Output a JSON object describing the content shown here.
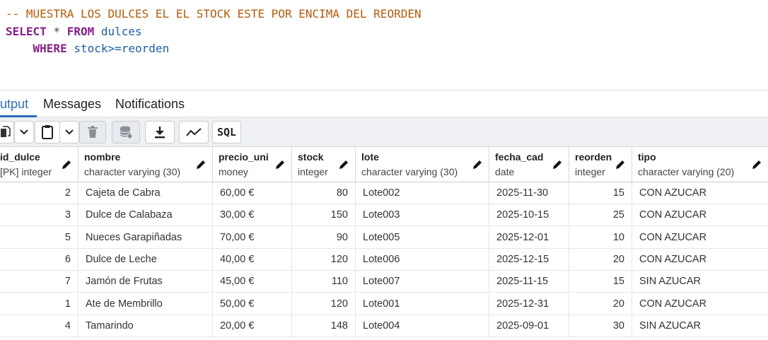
{
  "editor": {
    "line1": {
      "comment": "-- MUESTRA LOS DULCES EL EL STOCK ESTE POR ENCIMA DEL REORDEN"
    },
    "line2": {
      "kw_select": "SELECT",
      "star": " * ",
      "kw_from": "FROM",
      "table": " dulces"
    },
    "line3": {
      "indent": "    ",
      "kw_where": "WHERE",
      "condition": " stock>=reorden"
    }
  },
  "tabs": [
    {
      "label": "utput",
      "active": true
    },
    {
      "label": "Messages",
      "active": false
    },
    {
      "label": "Notifications",
      "active": false
    }
  ],
  "toolbar": {
    "sql_label": "SQL",
    "icons": [
      "copy-icon",
      "chevron-down-icon",
      "paste-icon",
      "chevron-down-icon",
      "delete-icon",
      "save-data-icon",
      "download-icon",
      "graph-icon"
    ]
  },
  "grid": {
    "columns": [
      {
        "name": "id_dulce",
        "type": "[PK] integer"
      },
      {
        "name": "nombre",
        "type": "character varying (30)"
      },
      {
        "name": "precio_uni",
        "type": "money"
      },
      {
        "name": "stock",
        "type": "integer"
      },
      {
        "name": "lote",
        "type": "character varying (30)"
      },
      {
        "name": "fecha_cad",
        "type": "date"
      },
      {
        "name": "reorden",
        "type": "integer"
      },
      {
        "name": "tipo",
        "type": "character varying (20)"
      }
    ],
    "rows": [
      [
        "2",
        "Cajeta de Cabra",
        "60,00 €",
        "80",
        "Lote002",
        "2025-11-30",
        "15",
        "CON AZUCAR"
      ],
      [
        "3",
        "Dulce de Calabaza",
        "30,00 €",
        "150",
        "Lote003",
        "2025-10-15",
        "25",
        "CON AZUCAR"
      ],
      [
        "5",
        "Nueces Garapiñadas",
        "70,00 €",
        "90",
        "Lote005",
        "2025-12-01",
        "10",
        "CON AZUCAR"
      ],
      [
        "6",
        "Dulce de Leche",
        "40,00 €",
        "120",
        "Lote006",
        "2025-12-15",
        "20",
        "CON AZUCAR"
      ],
      [
        "7",
        "Jamón de Frutas",
        "45,00 €",
        "110",
        "Lote007",
        "2025-11-15",
        "15",
        "SIN AZUCAR"
      ],
      [
        "1",
        "Ate de Membrillo",
        "50,00 €",
        "120",
        "Lote001",
        "2025-12-31",
        "20",
        "CON AZUCAR"
      ],
      [
        "4",
        "Tamarindo",
        "20,00 €",
        "148",
        "Lote004",
        "2025-09-01",
        "30",
        "SIN AZUCAR"
      ]
    ]
  },
  "colors": {
    "comment": "#b45b0a",
    "keyword": "#8a1d8b",
    "identifier": "#1f5fa8",
    "active_tab": "#2f6db5"
  }
}
